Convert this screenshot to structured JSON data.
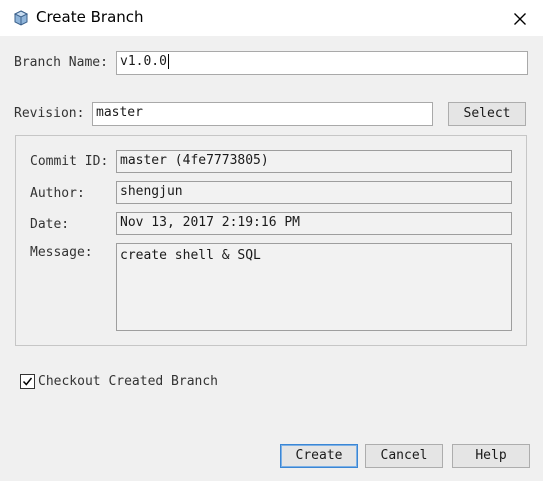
{
  "window": {
    "title": "Create Branch",
    "icon": "cube-icon",
    "close_icon": "close-icon"
  },
  "branch_name": {
    "label": "Branch Name:",
    "value": "v1.0.0"
  },
  "revision": {
    "label": "Revision:",
    "value": "master",
    "select_label": "Select"
  },
  "commit": {
    "id_label": "Commit ID:",
    "id_value": "master (4fe7773805)",
    "author_label": "Author:",
    "author_value": "shengjun",
    "date_label": "Date:",
    "date_value": "Nov 13, 2017 2:19:16 PM",
    "message_label": "Message:",
    "message_value": "create shell & SQL"
  },
  "checkout": {
    "label": "Checkout Created Branch",
    "checked": true
  },
  "buttons": {
    "create": "Create",
    "cancel": "Cancel",
    "help": "Help"
  },
  "colors": {
    "accent": "#3b86d4",
    "background": "#f0f0f0"
  }
}
